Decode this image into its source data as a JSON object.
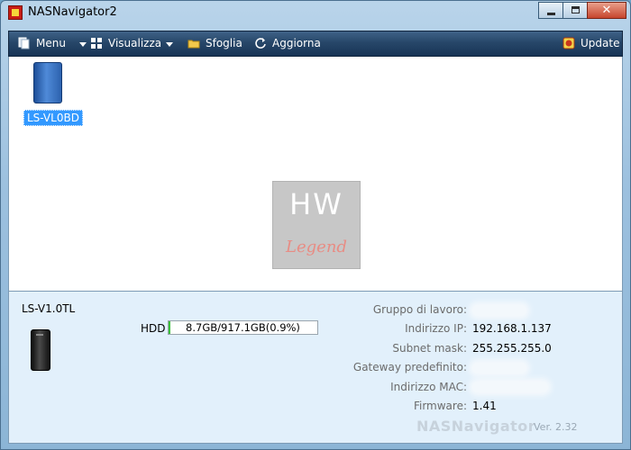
{
  "window": {
    "title": "NASNavigator2",
    "close_glyph": "✕"
  },
  "toolbar": {
    "menu_label": "Menu",
    "view_label": "Visualizza",
    "browse_label": "Sfoglia",
    "refresh_label": "Aggiorna",
    "update_label": "Update"
  },
  "devices": [
    {
      "label": "LS-VL0BD"
    }
  ],
  "watermark": {
    "hw": "HW",
    "legend": "Legend"
  },
  "details": {
    "device_name": "LS-V1.0TL",
    "hdd_label": "HDD",
    "hdd_usage_text": "8.7GB/917.1GB(0.9%)",
    "hdd_usage_fraction": 0.009,
    "info": [
      {
        "label": "Gruppo di lavoro:",
        "value": ""
      },
      {
        "label": "Indirizzo IP:",
        "value": "192.168.1.137"
      },
      {
        "label": "Subnet mask:",
        "value": "255.255.255.0"
      },
      {
        "label": "Gateway predefinito:",
        "value": ""
      },
      {
        "label": "Indirizzo MAC:",
        "value": ""
      },
      {
        "label": "Firmware:",
        "value": "1.41"
      }
    ],
    "brand": "NASNavigator",
    "version": "Ver. 2.32"
  },
  "colors": {
    "toolbar": "#274769",
    "selection": "#3399ff",
    "hdd_fill": "#3cc23c",
    "panel": "#e2f0fb"
  },
  "icons": [
    "app-icon",
    "menu-icon",
    "view-icon",
    "folder-icon",
    "refresh-icon",
    "update-icon",
    "nas-device-icon"
  ]
}
